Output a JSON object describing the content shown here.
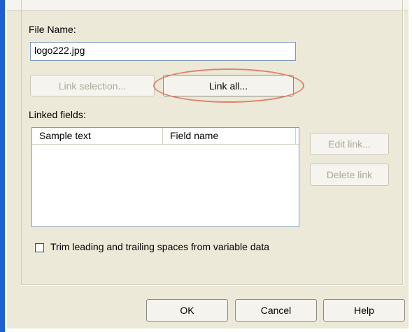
{
  "file_name": {
    "label": "File Name:",
    "value": "logo222.jpg"
  },
  "buttons": {
    "link_selection": "Link selection...",
    "link_all": "Link all...",
    "edit_link": "Edit link...",
    "delete_link": "Delete link",
    "ok": "OK",
    "cancel": "Cancel",
    "help": "Help"
  },
  "linked_fields": {
    "label": "Linked fields:",
    "columns": [
      "Sample text",
      "Field name"
    ]
  },
  "trim_checkbox": {
    "label": "Trim leading and trailing spaces from variable data",
    "checked": false
  },
  "highlight_color": "#e0806a",
  "accent_color": "#1f5fd6"
}
